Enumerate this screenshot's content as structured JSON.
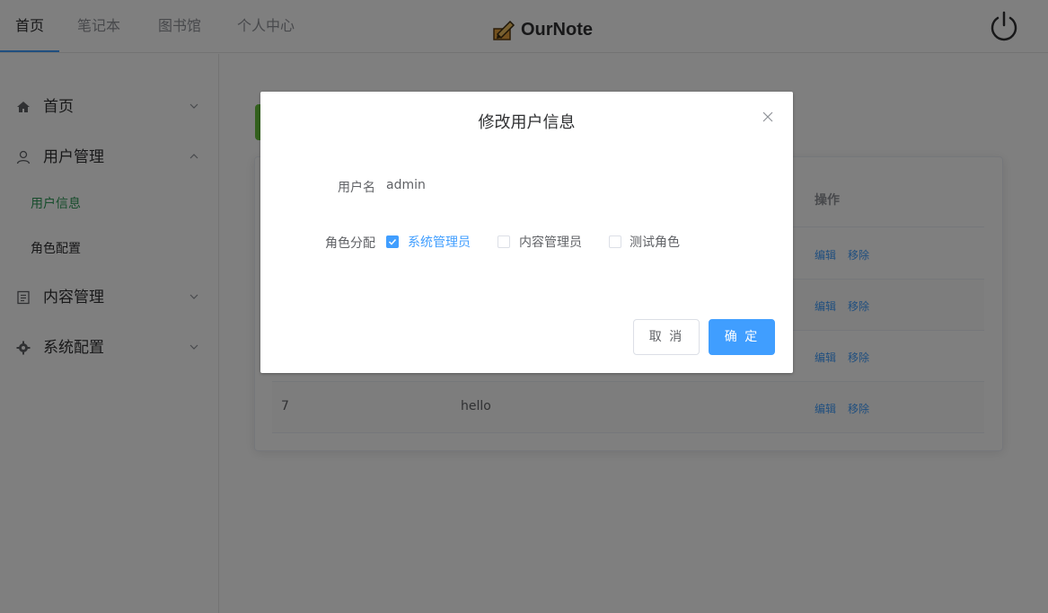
{
  "topnav": {
    "tabs": [
      {
        "label": "首页",
        "active": true
      },
      {
        "label": "笔记本",
        "active": false
      },
      {
        "label": "图书馆",
        "active": false
      },
      {
        "label": "个人中心",
        "active": false
      }
    ],
    "brand": "OurNote",
    "logo_icon": "pencil-notebook-icon",
    "power_icon": "power-icon"
  },
  "sidebar": {
    "items": [
      {
        "label": "首页",
        "icon": "home-icon",
        "expanded": false
      },
      {
        "label": "用户管理",
        "icon": "user-icon",
        "expanded": true
      },
      {
        "label": "内容管理",
        "icon": "document-icon",
        "expanded": false
      },
      {
        "label": "系统配置",
        "icon": "gear-icon",
        "expanded": false
      }
    ],
    "sub_items": [
      {
        "label": "用户信息",
        "active": true
      },
      {
        "label": "角色配置",
        "active": false
      }
    ]
  },
  "table": {
    "op_header": "操作",
    "rows": [
      {
        "id": "",
        "name": "",
        "edit": "编辑",
        "remove": "移除"
      },
      {
        "id": "",
        "name": "",
        "edit": "编辑",
        "remove": "移除"
      },
      {
        "id": "",
        "name": "",
        "edit": "编辑",
        "remove": "移除"
      },
      {
        "id": "7",
        "name": "hello",
        "edit": "编辑",
        "remove": "移除"
      }
    ]
  },
  "dialog": {
    "title": "修改用户信息",
    "username_label": "用户名",
    "username_value": "admin",
    "role_label": "角色分配",
    "roles": [
      {
        "label": "系统管理员",
        "checked": true
      },
      {
        "label": "内容管理员",
        "checked": false
      },
      {
        "label": "测试角色",
        "checked": false
      }
    ],
    "cancel_label": "取 消",
    "ok_label": "确 定"
  },
  "colors": {
    "primary": "#409eff",
    "success": "#67c23a",
    "active_submenu": "#2e9a58",
    "overlay": "rgba(0,0,0,0.5)"
  }
}
